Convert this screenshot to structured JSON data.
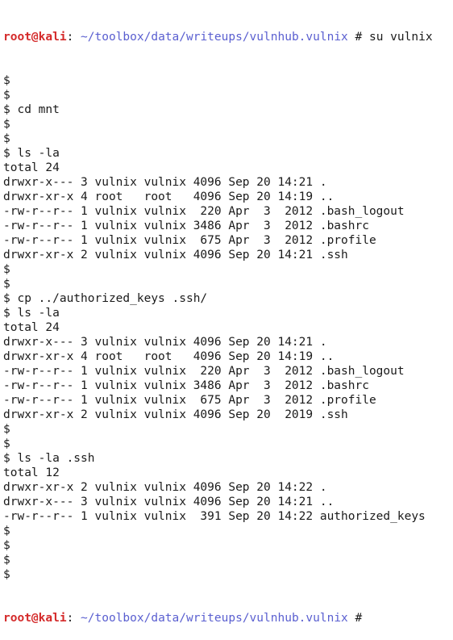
{
  "colors": {
    "background": "#ffffff",
    "text": "#1a1a1a",
    "prompt_user": "#d42a2a",
    "prompt_path": "#5a5fd0"
  },
  "prompt_top": {
    "user_host": "root@kali",
    "separator": ": ",
    "path": "~/toolbox/data/writeups/vulnhub.vulnix",
    "symbol": " # ",
    "command": "su vulnix"
  },
  "lines": [
    "$",
    "$",
    "$ cd mnt",
    "$",
    "$",
    "$ ls -la",
    "total 24",
    "drwxr-x--- 3 vulnix vulnix 4096 Sep 20 14:21 .",
    "drwxr-xr-x 4 root   root   4096 Sep 20 14:19 ..",
    "-rw-r--r-- 1 vulnix vulnix  220 Apr  3  2012 .bash_logout",
    "-rw-r--r-- 1 vulnix vulnix 3486 Apr  3  2012 .bashrc",
    "-rw-r--r-- 1 vulnix vulnix  675 Apr  3  2012 .profile",
    "drwxr-xr-x 2 vulnix vulnix 4096 Sep 20 14:21 .ssh",
    "$",
    "$",
    "$ cp ../authorized_keys .ssh/",
    "$ ls -la",
    "total 24",
    "drwxr-x--- 3 vulnix vulnix 4096 Sep 20 14:21 .",
    "drwxr-xr-x 4 root   root   4096 Sep 20 14:19 ..",
    "-rw-r--r-- 1 vulnix vulnix  220 Apr  3  2012 .bash_logout",
    "-rw-r--r-- 1 vulnix vulnix 3486 Apr  3  2012 .bashrc",
    "-rw-r--r-- 1 vulnix vulnix  675 Apr  3  2012 .profile",
    "drwxr-xr-x 2 vulnix vulnix 4096 Sep 20  2019 .ssh",
    "$",
    "$",
    "$ ls -la .ssh",
    "total 12",
    "drwxr-xr-x 2 vulnix vulnix 4096 Sep 20 14:22 .",
    "drwxr-x--- 3 vulnix vulnix 4096 Sep 20 14:21 ..",
    "-rw-r--r-- 1 vulnix vulnix  391 Sep 20 14:22 authorized_keys",
    "$",
    "$",
    "$",
    "$"
  ],
  "prompt_bottom": {
    "user_host": "root@kali",
    "separator": ": ",
    "path": "~/toolbox/data/writeups/vulnhub.vulnix",
    "symbol": " #",
    "command": ""
  }
}
